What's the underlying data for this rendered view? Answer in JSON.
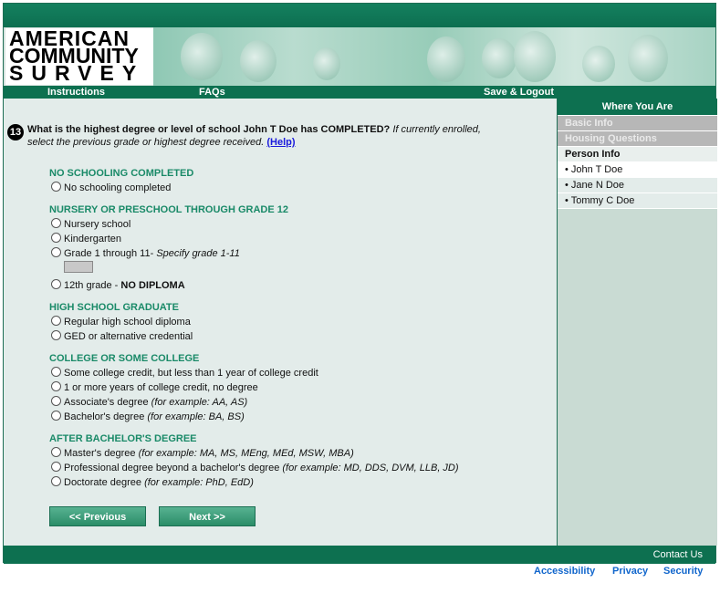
{
  "logo": {
    "line1": "AMERICAN",
    "line2": "COMMUNITY",
    "line3": "SURVEY"
  },
  "nav": {
    "instructions": "Instructions",
    "faqs": "FAQs",
    "save_logout": "Save & Logout"
  },
  "sidebar": {
    "title": "Where You Are",
    "items": [
      {
        "label": "Basic Info"
      },
      {
        "label": "Housing Questions"
      },
      {
        "label": "Person Info"
      },
      {
        "label": "• John T Doe"
      },
      {
        "label": "• Jane N Doe"
      },
      {
        "label": "• Tommy C Doe"
      }
    ]
  },
  "question": {
    "number": "13",
    "text": "What is the highest degree or level of school John T Doe has COMPLETED?",
    "note": "If currently enrolled, select the previous grade or highest degree received.",
    "help": "(Help)"
  },
  "sections": {
    "no_schooling": "NO SCHOOLING COMPLETED",
    "nursery": "NURSERY OR PRESCHOOL THROUGH GRADE 12",
    "high_school": "HIGH SCHOOL GRADUATE",
    "college": "COLLEGE OR SOME COLLEGE",
    "after_bachelor": "AFTER BACHELOR'S DEGREE"
  },
  "options": {
    "no_schooling": "No schooling completed",
    "nursery_school": "Nursery school",
    "kindergarten": "Kindergarten",
    "grade_1_11": "Grade 1 through 11-",
    "grade_1_11_note": "Specify grade 1-11",
    "grade_12": "12th grade -",
    "grade_12_bold": "NO DIPLOMA",
    "regular_diploma": "Regular high school diploma",
    "ged": "GED or alternative credential",
    "some_college": "Some college credit, but less than 1 year of college credit",
    "one_year": "1 or more years of college credit, no degree",
    "associate": "Associate's degree",
    "associate_ex": "(for example: AA, AS)",
    "bachelor": "Bachelor's degree",
    "bachelor_ex": "(for example: BA, BS)",
    "masters": "Master's degree",
    "masters_ex": "(for example: MA, MS, MEng, MEd, MSW, MBA)",
    "professional": "Professional degree beyond a bachelor's degree",
    "professional_ex": "(for example: MD, DDS, DVM, LLB, JD)",
    "doctorate": "Doctorate degree",
    "doctorate_ex": "(for example: PhD, EdD)"
  },
  "buttons": {
    "previous": "<<   Previous",
    "next": "Next   >>"
  },
  "footer": {
    "contact": "Contact Us",
    "accessibility": "Accessibility",
    "privacy": "Privacy",
    "security": "Security"
  }
}
